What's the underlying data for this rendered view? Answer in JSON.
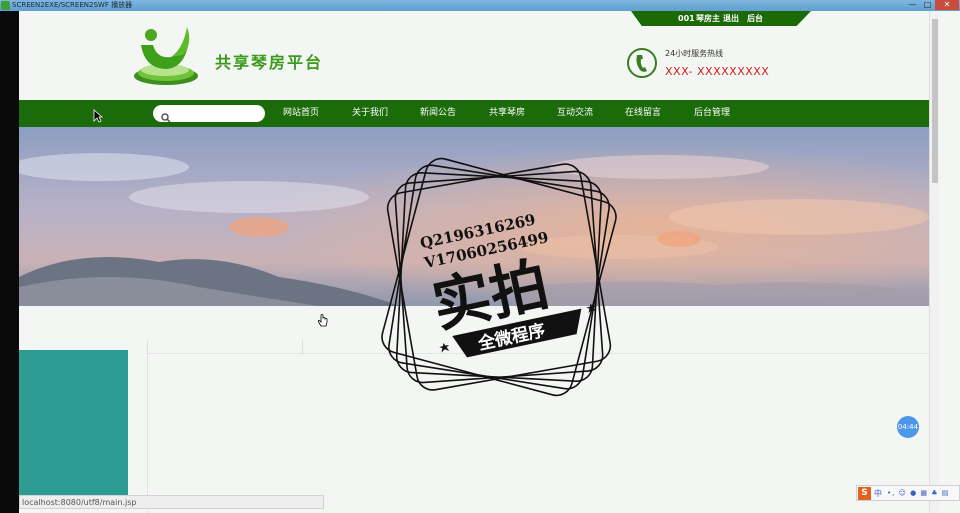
{
  "window": {
    "title": "SCREEN2EXE/SCREEN2SWF 播放器",
    "minimize": "—",
    "maximize": "□",
    "close": "✕"
  },
  "colors": {
    "brand_green": "#1c6b0a",
    "site_name_green": "#3b9a1c",
    "hotline_red": "#d0241c",
    "sidebar_teal": "#2d9c93"
  },
  "topbar": {
    "user": "001",
    "role": "琴房主",
    "logout": "退出",
    "admin": "后台"
  },
  "header": {
    "site_name": "共享琴房平台",
    "hotline_label": "24小时服务热线",
    "hotline_number": "XXX- XXXXXXXXX"
  },
  "search": {
    "placeholder": "",
    "value": ""
  },
  "nav": {
    "items": [
      "网站首页",
      "关于我们",
      "新闻公告",
      "共享琴房",
      "互动交流",
      "在线留言",
      "后台管理"
    ]
  },
  "watermark": {
    "line1": "Q2196316269",
    "line2": "V17060256499",
    "big": "实拍",
    "ribbon": "全微程序"
  },
  "status": {
    "url": "localhost:8080/utf8/main.jsp"
  },
  "time_badge": "04:44",
  "ime": {
    "logo": "S",
    "mode": "中",
    "tray": "•, ☺ ● ▦ ♣ ▤"
  }
}
